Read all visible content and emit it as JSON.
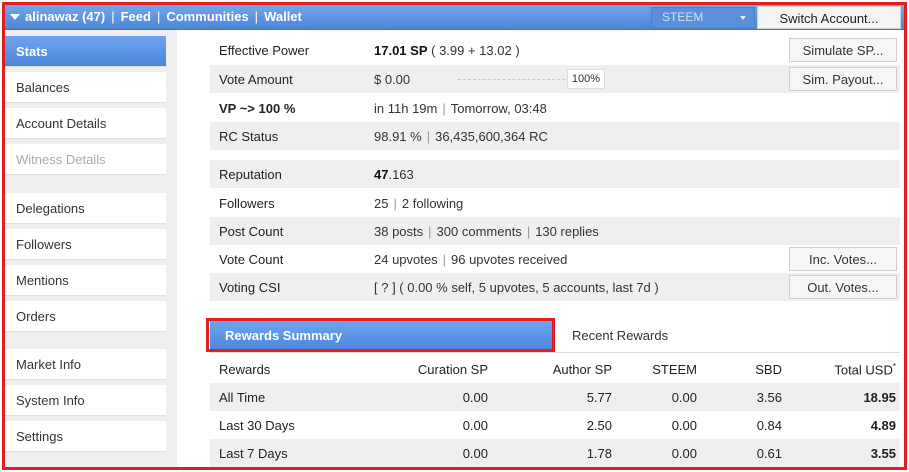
{
  "topbar": {
    "account": "alinawaz (47)",
    "nav": [
      "Feed",
      "Communities",
      "Wallet"
    ],
    "separator": "|",
    "token_select": "STEEM",
    "switch_account": "Switch Account..."
  },
  "sidebar": {
    "items": [
      {
        "label": "Stats",
        "state": "active"
      },
      {
        "label": "Balances",
        "state": "normal"
      },
      {
        "label": "Account Details",
        "state": "normal"
      },
      {
        "label": "Witness Details",
        "state": "disabled"
      },
      {
        "label": "Delegations",
        "state": "normal"
      },
      {
        "label": "Followers",
        "state": "normal"
      },
      {
        "label": "Mentions",
        "state": "normal"
      },
      {
        "label": "Orders",
        "state": "normal"
      },
      {
        "label": "Market Info",
        "state": "normal"
      },
      {
        "label": "System Info",
        "state": "normal"
      },
      {
        "label": "Settings",
        "state": "normal"
      }
    ]
  },
  "stats": {
    "effective_power": {
      "label": "Effective Power",
      "value_bold": "17.01 SP",
      "value_rest": "( 3.99 + 13.02 )",
      "button": "Simulate SP..."
    },
    "vote_amount": {
      "label": "Vote Amount",
      "value": "$ 0.00",
      "percent": "100%",
      "button": "Sim. Payout..."
    },
    "vp": {
      "label": "VP ~> 100 %",
      "value_a": "in 11h 19m",
      "value_b": "Tomorrow, 03:48"
    },
    "rc_status": {
      "label": "RC Status",
      "value_a": "98.91 %",
      "value_b": "36,435,600,364 RC"
    },
    "reputation": {
      "label": "Reputation",
      "value_bold": "47",
      "value_rest": ".163"
    },
    "followers": {
      "label": "Followers",
      "value_a": "25",
      "value_b": "2 following"
    },
    "post_count": {
      "label": "Post Count",
      "value_a": "38 posts",
      "value_b": "300 comments",
      "value_c": "130 replies"
    },
    "vote_count": {
      "label": "Vote Count",
      "value_a": "24 upvotes",
      "value_b": "96 upvotes received",
      "button": "Inc. Votes..."
    },
    "voting_csi": {
      "label": "Voting CSI",
      "value": "[ ? ] ( 0.00 % self, 5 upvotes, 5 accounts, last 7d )",
      "button": "Out. Votes..."
    }
  },
  "tabs": {
    "active": "Rewards Summary",
    "other": "Recent Rewards"
  },
  "rewards": {
    "headers": [
      "Rewards",
      "Curation SP",
      "Author SP",
      "STEEM",
      "SBD",
      "Total USD"
    ],
    "header_mark": "*",
    "rows": [
      [
        "All Time",
        "0.00",
        "5.77",
        "0.00",
        "3.56",
        "18.95"
      ],
      [
        "Last 30 Days",
        "0.00",
        "2.50",
        "0.00",
        "0.84",
        "4.89"
      ],
      [
        "Last 7 Days",
        "0.00",
        "1.78",
        "0.00",
        "0.61",
        "3.55"
      ]
    ]
  },
  "colors": {
    "accent_blue": "#4f86d6",
    "highlight_red": "#e02020",
    "row_shade": "#efefef"
  }
}
